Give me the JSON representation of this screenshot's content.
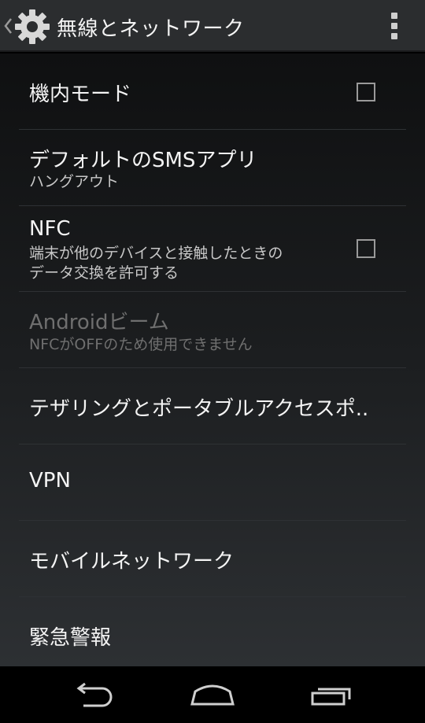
{
  "header": {
    "title": "無線とネットワーク",
    "icons": [
      "up-caret-icon",
      "gear-icon",
      "overflow-menu-icon"
    ]
  },
  "settings": [
    {
      "title": "機内モード",
      "summary": "",
      "checkbox": true,
      "checked": false,
      "enabled": true
    },
    {
      "title": "デフォルトのSMSアプリ",
      "summary": "ハングアウト",
      "checkbox": false,
      "enabled": true
    },
    {
      "title": "NFC",
      "summary_line1": "端末が他のデバイスと接触したときの",
      "summary_line2": "データ交換を許可する",
      "checkbox": true,
      "checked": false,
      "enabled": true
    },
    {
      "title": "Androidビーム",
      "summary": "NFCがOFFのため使用できません",
      "checkbox": false,
      "enabled": false
    },
    {
      "title": "テザリングとポータブルアクセスポ..",
      "summary": "",
      "checkbox": false,
      "enabled": true
    },
    {
      "title": "VPN",
      "summary": "",
      "checkbox": false,
      "enabled": true
    },
    {
      "title": "モバイルネットワーク",
      "summary": "",
      "checkbox": false,
      "enabled": true
    },
    {
      "title": "緊急警報",
      "summary": "",
      "checkbox": false,
      "enabled": true
    }
  ],
  "navbar": {
    "icons": [
      "back-icon",
      "home-icon",
      "recent-apps-icon"
    ]
  },
  "colors": {
    "actionbar": "#2b2d2f",
    "text": "#f4f4f4",
    "summary": "#c8c8c8",
    "disabled": "#6f6f6f"
  }
}
